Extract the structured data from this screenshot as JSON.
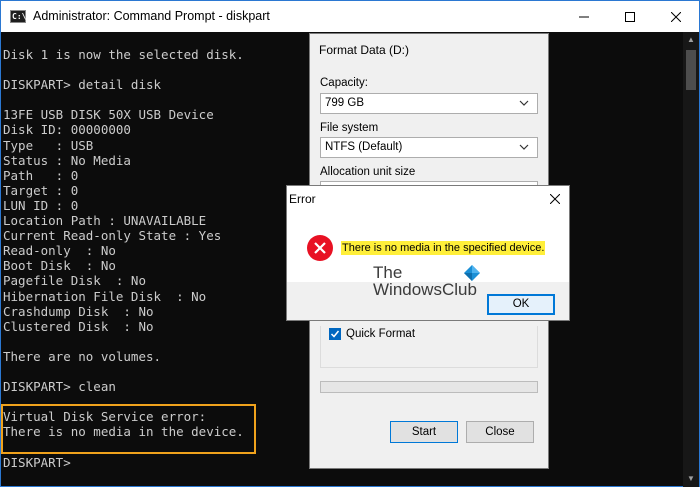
{
  "window": {
    "title": "Administrator: Command Prompt - diskpart",
    "app_icon_text": "C:\\"
  },
  "console": {
    "lines": [
      "Disk 1 is now the selected disk.",
      "",
      "DISKPART> detail disk",
      "",
      "13FE USB DISK 50X USB Device",
      "Disk ID: 00000000",
      "Type   : USB",
      "Status : No Media",
      "Path   : 0",
      "Target : 0",
      "LUN ID : 0",
      "Location Path : UNAVAILABLE",
      "Current Read-only State : Yes",
      "Read-only  : No",
      "Boot Disk  : No",
      "Pagefile Disk  : No",
      "Hibernation File Disk  : No",
      "Crashdump Disk  : No",
      "Clustered Disk  : No",
      "",
      "There are no volumes.",
      "",
      "DISKPART> clean",
      "",
      "Virtual Disk Service error:",
      "There is no media in the device.",
      "",
      "DISKPART>"
    ]
  },
  "format_dialog": {
    "title": "Format Data (D:)",
    "capacity_label": "Capacity:",
    "capacity_value": "799 GB",
    "filesystem_label": "File system",
    "filesystem_value": "NTFS (Default)",
    "allocation_label": "Allocation unit size",
    "quick_format_label": "Quick Format",
    "quick_format_checked": true,
    "start_label": "Start",
    "close_label": "Close"
  },
  "error_dialog": {
    "title": "Error",
    "message": "There is no media in the specified device.",
    "ok_label": "OK"
  },
  "watermark": {
    "line1": "The",
    "line2": "WindowsClub"
  },
  "colors": {
    "console_bg": "#0c0c0c",
    "console_text": "#cccccc",
    "highlight_box": "#f0a21c",
    "error_highlight": "#ffef3a",
    "accent": "#0078d7",
    "error_red": "#e81123"
  }
}
